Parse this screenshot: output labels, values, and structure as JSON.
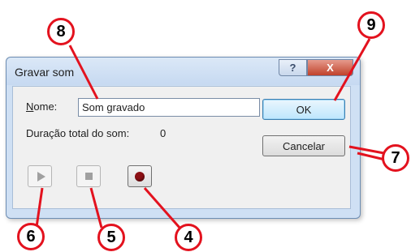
{
  "dialog": {
    "title": "Gravar som",
    "help_glyph": "?",
    "close_glyph": "X",
    "name_label": "Nome:",
    "name_value": "Som gravado",
    "duration_label": "Duração total do som:",
    "duration_value": "0",
    "ok_label": "OK",
    "cancel_label": "Cancelar",
    "media_buttons": [
      {
        "name": "play-button",
        "icon": "play-icon",
        "enabled": false
      },
      {
        "name": "stop-button",
        "icon": "stop-icon",
        "enabled": false
      },
      {
        "name": "record-button",
        "icon": "record-icon",
        "enabled": true
      }
    ]
  },
  "callouts": [
    "8",
    "9",
    "7",
    "6",
    "5",
    "4"
  ],
  "colors": {
    "callout_red": "#e3121e",
    "record_dot": "#8b0f14",
    "close_button": "#c0422b"
  }
}
